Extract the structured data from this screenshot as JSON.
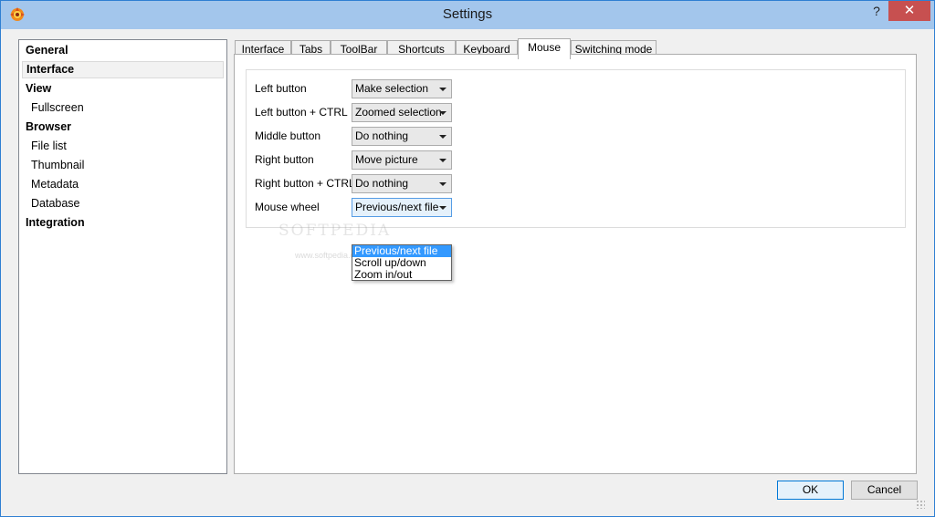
{
  "window": {
    "title": "Settings",
    "help_label": "?",
    "close_label": "✕"
  },
  "nav": {
    "items": [
      {
        "label": "General",
        "level": "group"
      },
      {
        "label": "Interface",
        "level": "group",
        "selected": true
      },
      {
        "label": "View",
        "level": "group"
      },
      {
        "label": "Fullscreen",
        "level": "child"
      },
      {
        "label": "Browser",
        "level": "group"
      },
      {
        "label": "File list",
        "level": "child"
      },
      {
        "label": "Thumbnail",
        "level": "child"
      },
      {
        "label": "Metadata",
        "level": "child"
      },
      {
        "label": "Database",
        "level": "child"
      },
      {
        "label": "Integration",
        "level": "group"
      }
    ]
  },
  "tabs": [
    {
      "label": "Interface"
    },
    {
      "label": "Tabs"
    },
    {
      "label": "ToolBar"
    },
    {
      "label": "Shortcuts"
    },
    {
      "label": "Keyboard"
    },
    {
      "label": "Mouse",
      "active": true
    },
    {
      "label": "Switching mode"
    }
  ],
  "mouse": {
    "rows": [
      {
        "label": "Left button",
        "value": "Make selection"
      },
      {
        "label": "Left button + CTRL",
        "value": "Zoomed selection"
      },
      {
        "label": "Middle button",
        "value": "Do nothing"
      },
      {
        "label": "Right button",
        "value": "Move picture"
      },
      {
        "label": "Right button + CTRL",
        "value": "Do nothing"
      },
      {
        "label": "Mouse wheel",
        "value": "Previous/next file",
        "open": true
      }
    ],
    "wheel_options": [
      "Previous/next file",
      "Scroll up/down",
      "Zoom in/out"
    ],
    "wheel_selected_index": 0
  },
  "watermark": {
    "main": "SOFTPEDIA",
    "url": "www.softpedia.com"
  },
  "footer": {
    "ok_label": "OK",
    "cancel_label": "Cancel"
  },
  "colors": {
    "titlebar": "#a3c6ec",
    "close_button": "#c75050",
    "selection": "#3399ff",
    "focus_border": "#569de5"
  }
}
